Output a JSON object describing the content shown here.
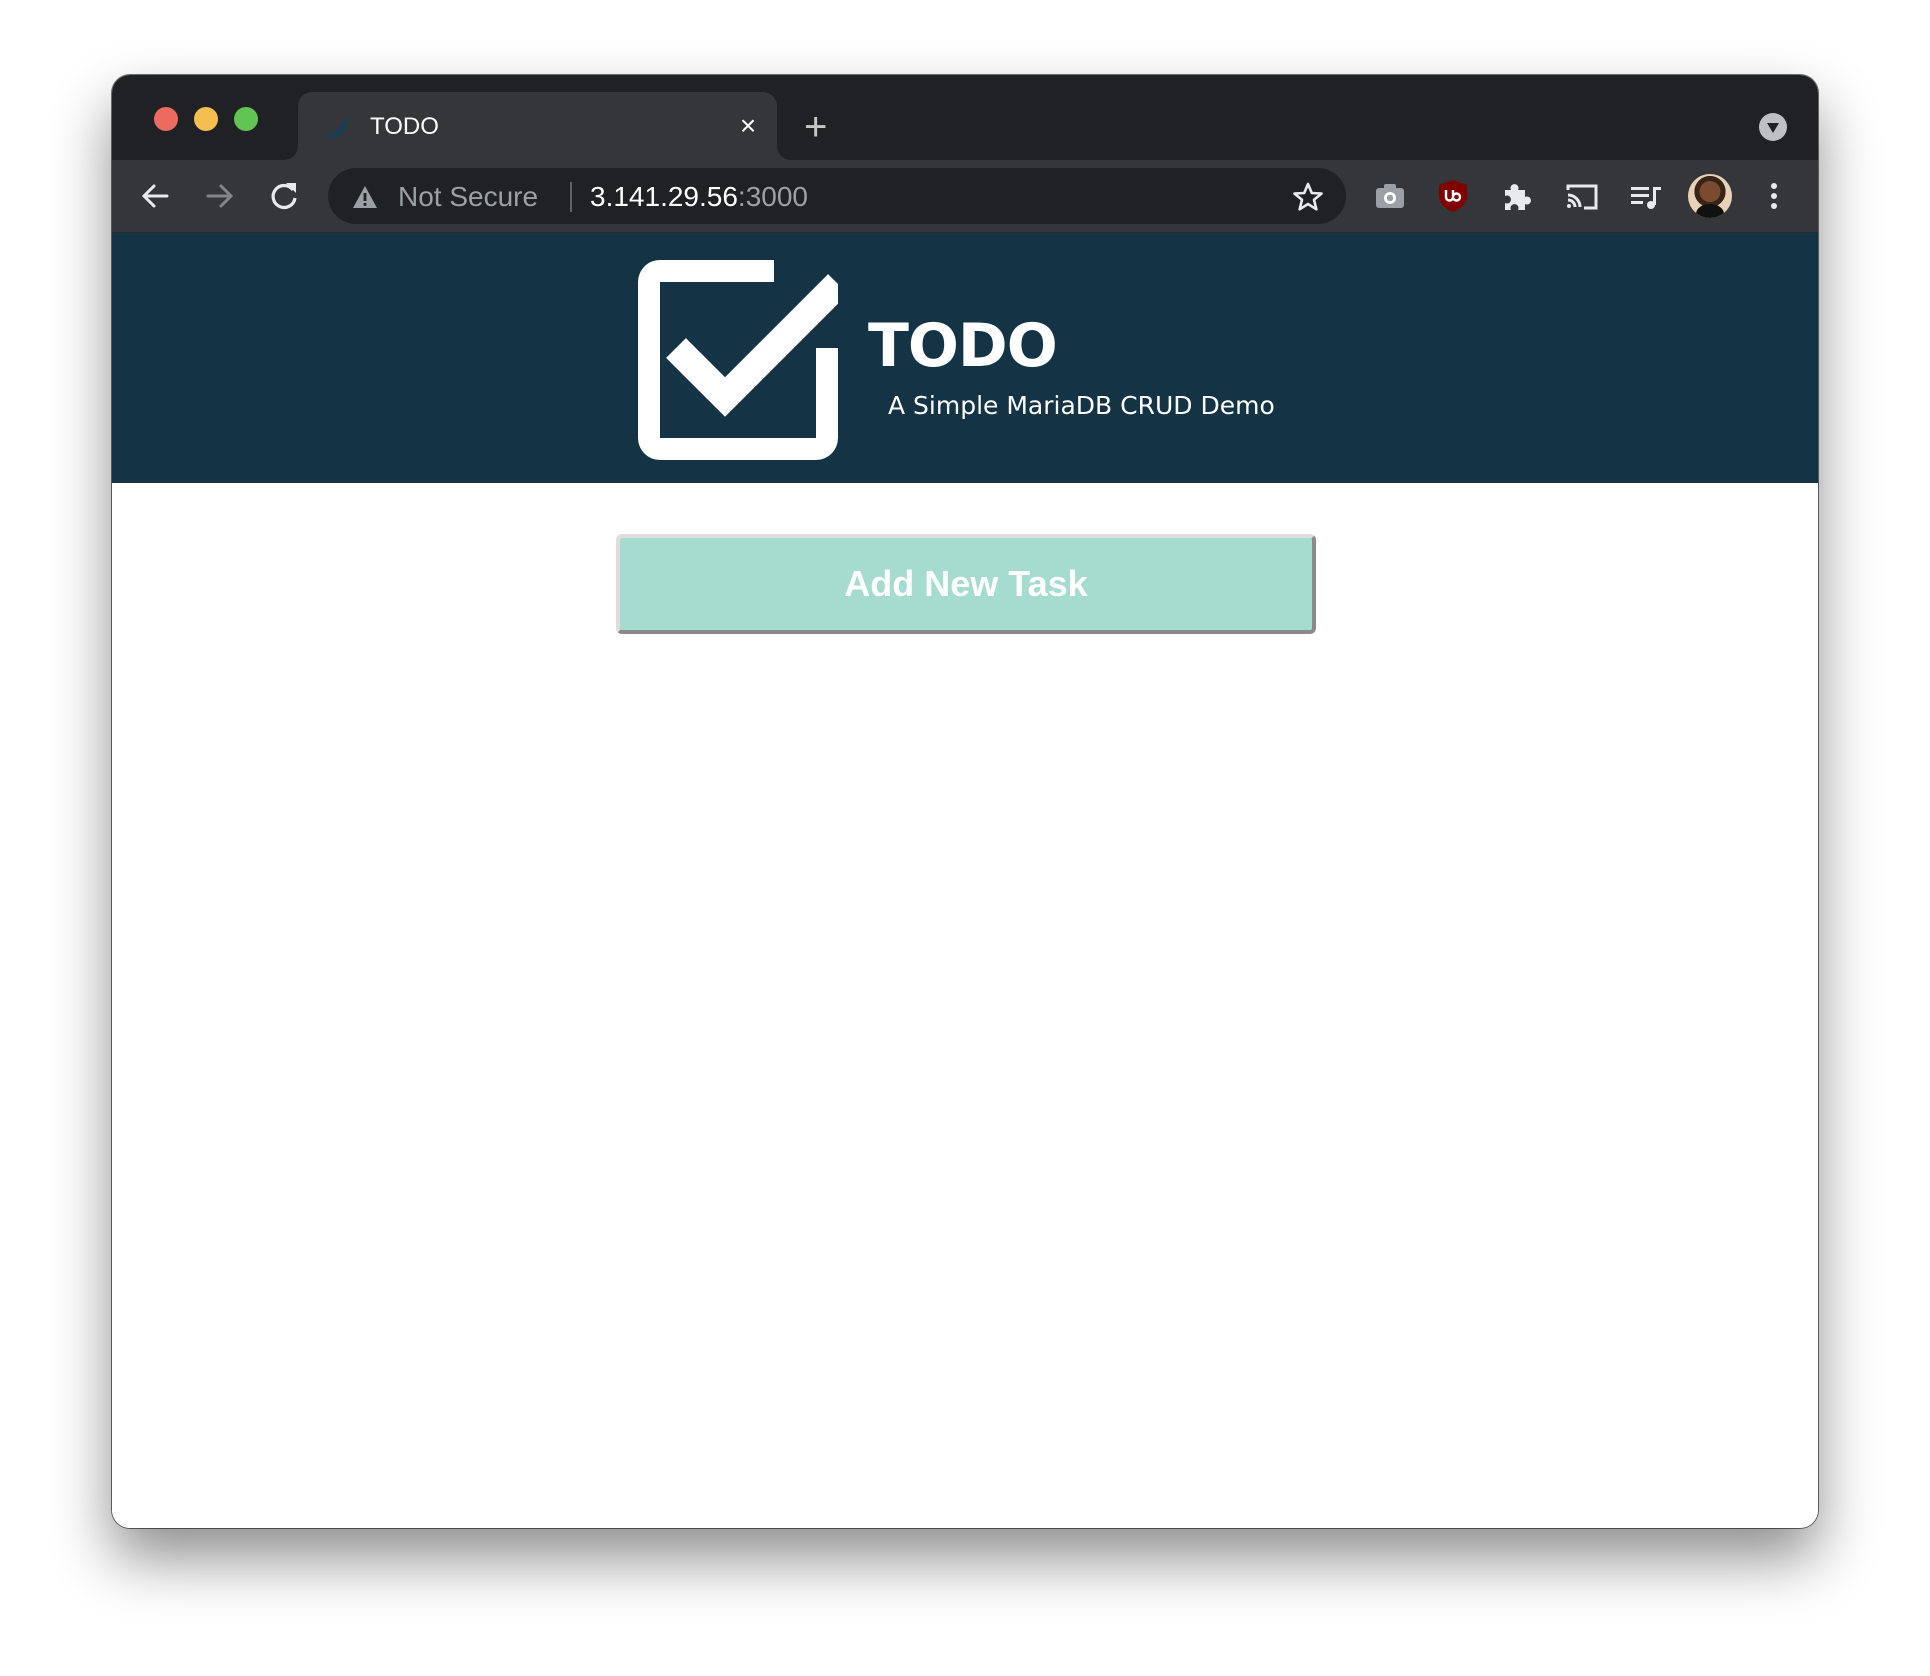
{
  "browser": {
    "tab": {
      "title": "TODO",
      "favicon": "mariadb-seal-icon",
      "close_label": "×"
    },
    "new_tab_label": "+",
    "omnibox": {
      "security_label": "Not Secure",
      "url_host": "3.141.29.56",
      "url_port": ":3000"
    },
    "toolbar_icons": [
      "back-icon",
      "forward-icon",
      "reload-icon",
      "star-icon",
      "camera-icon",
      "ublock-icon",
      "extensions-icon",
      "cast-icon",
      "media-control-icon",
      "profile-avatar",
      "more-menu-icon"
    ],
    "colors": {
      "tabstrip": "#202124",
      "toolbar": "#35363a",
      "omnibox": "#202124"
    }
  },
  "app": {
    "title": "TODO",
    "subtitle": "A Simple MariaDB CRUD Demo",
    "add_button_label": "Add New Task",
    "colors": {
      "header_bg": "#143445",
      "button_bg": "#a6dbcf",
      "button_text": "#ffffff"
    }
  }
}
